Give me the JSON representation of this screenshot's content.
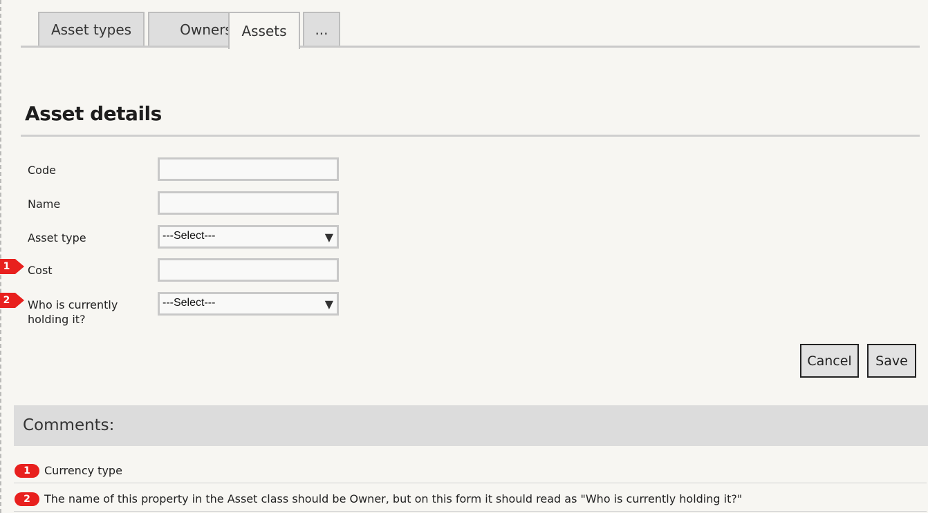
{
  "tabs": [
    {
      "label": "Asset types",
      "active": false
    },
    {
      "label": "Owners",
      "active": false
    },
    {
      "label": "Assets",
      "active": true
    },
    {
      "label": "...",
      "active": false
    }
  ],
  "page_title": "Asset details",
  "form": {
    "fields": [
      {
        "label": "Code",
        "type": "text",
        "value": ""
      },
      {
        "label": "Name",
        "type": "text",
        "value": ""
      },
      {
        "label": "Asset type",
        "type": "select",
        "value": "---Select---"
      },
      {
        "label": "Cost",
        "type": "text",
        "value": "",
        "marker": "1"
      },
      {
        "label": "Who is currently holding it?",
        "type": "select",
        "value": "---Select---",
        "marker": "2"
      }
    ]
  },
  "buttons": {
    "cancel": "Cancel",
    "save": "Save"
  },
  "comments": {
    "title": "Comments:",
    "items": [
      {
        "number": "1",
        "text": "Currency type"
      },
      {
        "number": "2",
        "text": "The name of this property in the Asset class should be Owner, but on this form it should read as \"Who is currently holding it?\""
      }
    ]
  },
  "colors": {
    "marker": "#e8201e",
    "comments_bar": "#dcdcdc",
    "background": "#f7f6f2"
  }
}
